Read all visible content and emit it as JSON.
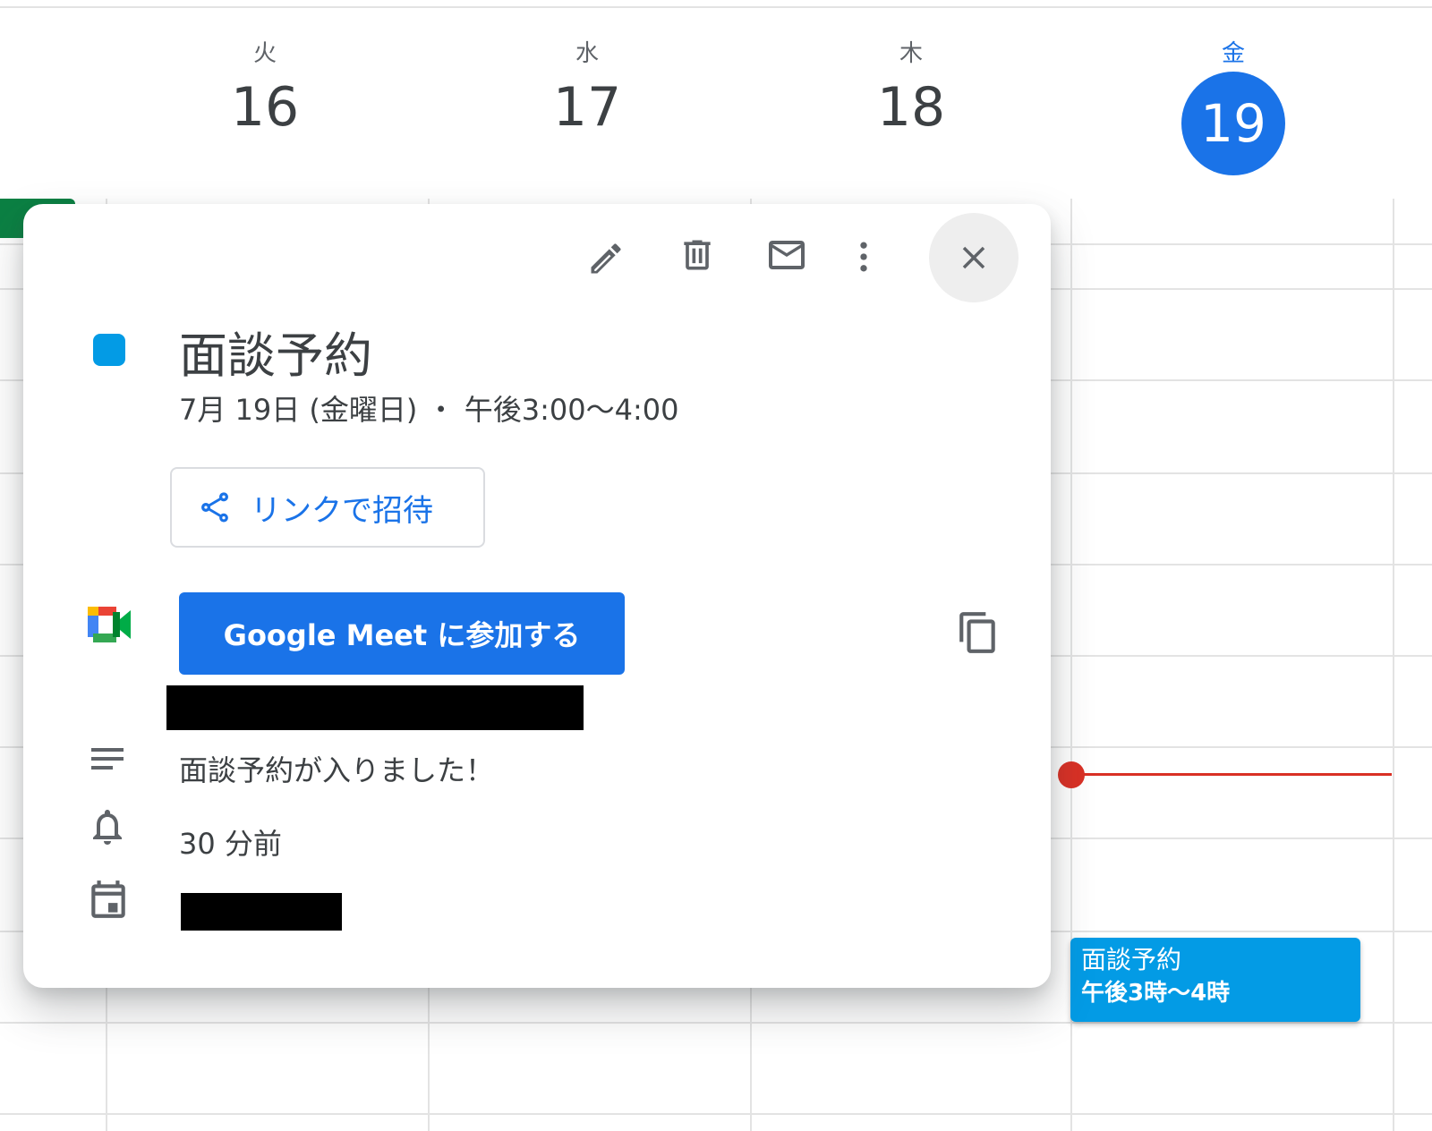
{
  "week": [
    {
      "dow": "火",
      "day": "16",
      "today": false
    },
    {
      "dow": "水",
      "day": "17",
      "today": false
    },
    {
      "dow": "木",
      "day": "18",
      "today": false
    },
    {
      "dow": "金",
      "day": "19",
      "today": true
    }
  ],
  "popup": {
    "title": "面談予約",
    "datetime": "7月 19日 (金曜日) ・ 午後3:00〜4:00",
    "invite_link_label": "リンクで招待",
    "meet_button_label": "Google Meet に参加する",
    "description": "面談予約が入りました！",
    "reminder": "30 分前",
    "event_color": "#039be5",
    "icons": [
      "edit-icon",
      "delete-icon",
      "email-icon",
      "more-vert-icon",
      "close-icon",
      "share-icon",
      "google-meet-icon",
      "copy-icon",
      "notes-icon",
      "bell-icon",
      "calendar-icon"
    ]
  },
  "calendar_event": {
    "title": "面談予約",
    "time": "午後3時〜4時"
  },
  "colors": {
    "accent": "#1a73e8",
    "now_line": "#d93025",
    "event": "#039be5",
    "green_event": "#0b8043"
  }
}
